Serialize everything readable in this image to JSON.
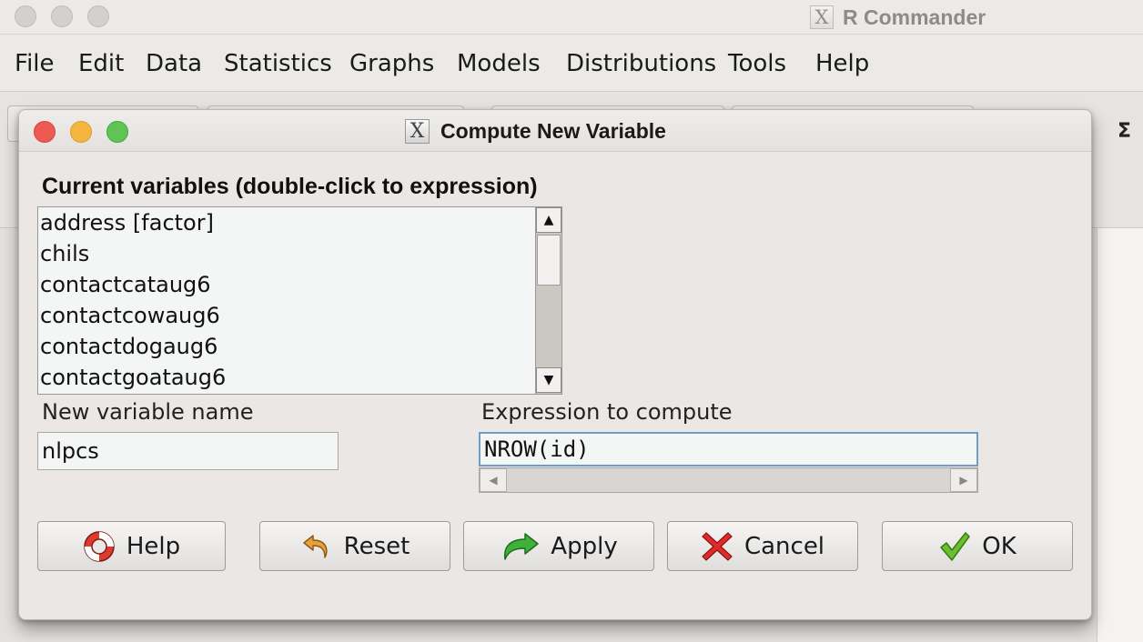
{
  "main_window": {
    "title": "R Commander",
    "x_glyph": "X",
    "menu": [
      "File",
      "Edit",
      "Data",
      "Statistics",
      "Graphs",
      "Models",
      "Distributions",
      "Tools",
      "Help"
    ],
    "toolbar_sigma": "Σ"
  },
  "dialog": {
    "title": "Compute New Variable",
    "x_glyph": "X",
    "variables_label": "Current variables (double-click to expression)",
    "variables": [
      "address [factor]",
      "chils",
      "contactcataug6",
      "contactcowaug6",
      "contactdogaug6",
      "contactgoataug6"
    ],
    "new_variable_label": "New variable name",
    "new_variable_value": "nlpcs",
    "expression_label": "Expression to compute",
    "expression_value": "NROW(id)",
    "buttons": {
      "help": "Help",
      "reset": "Reset",
      "apply": "Apply",
      "cancel": "Cancel",
      "ok": "OK"
    },
    "icons": {
      "help": "lifebuoy-icon",
      "reset": "undo-arrow-icon",
      "apply": "redo-arrow-icon",
      "cancel": "red-x-icon",
      "ok": "checkmark-icon"
    },
    "colors": {
      "close": "#ee5a52",
      "minimize": "#f4b63f",
      "maximize": "#5ec454",
      "focus_border": "#6d9ec9"
    }
  }
}
